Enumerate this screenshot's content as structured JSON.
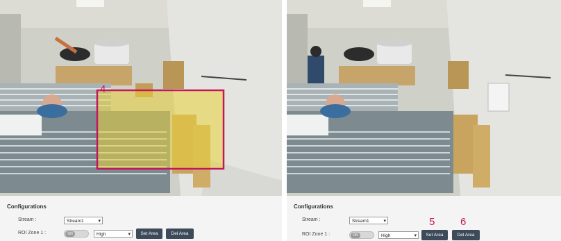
{
  "left": {
    "callout_number": "4",
    "configurations_title": "Configurations",
    "stream_label": "Stream :",
    "stream_value": "Stream1",
    "roi_label": "ROI Zone 1 :",
    "toggle_label": "ON",
    "level_value": "High",
    "set_area_label": "Set Area",
    "del_area_label": "Del Area"
  },
  "right": {
    "configurations_title": "Configurations",
    "stream_label": "Stream :",
    "stream_value": "Stream1",
    "roi_label": "ROI Zone 1 :",
    "toggle_label": "ON",
    "level_value": "High",
    "set_area_label": "Set Area",
    "del_area_label": "Del Area",
    "callout_set": "5",
    "callout_del": "6"
  },
  "colors": {
    "roi_border": "#c2185b",
    "roi_fill": "#e8d23a",
    "button_bg": "#3d4a5a",
    "callout": "#c2185b"
  },
  "icons": {
    "select_arrow": "chevron-down-icon"
  }
}
